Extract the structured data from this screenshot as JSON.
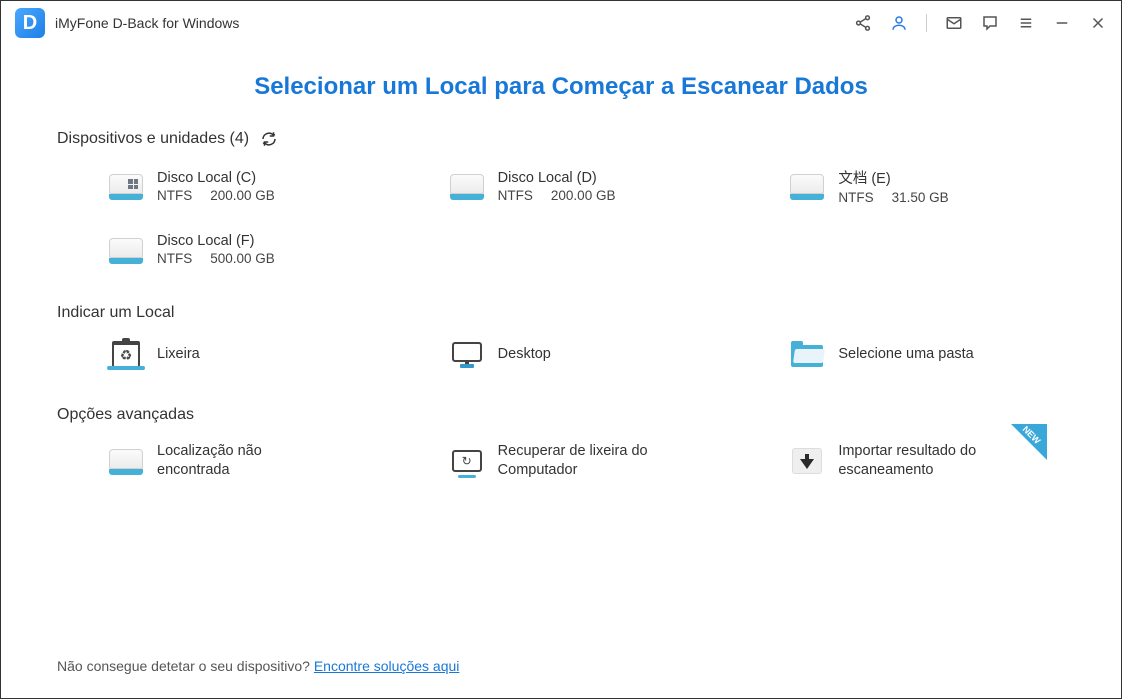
{
  "app": {
    "title": "iMyFone D-Back for Windows",
    "logo_letter": "D"
  },
  "page_title": "Selecionar um Local para Começar a Escanear Dados",
  "sections": {
    "devices": {
      "header": "Dispositivos e unidades (4)",
      "drives": [
        {
          "name": "Disco Local (C)",
          "fs": "NTFS",
          "size": "200.00 GB"
        },
        {
          "name": "Disco Local (D)",
          "fs": "NTFS",
          "size": "200.00 GB"
        },
        {
          "name": "文档 (E)",
          "fs": "NTFS",
          "size": "31.50 GB"
        },
        {
          "name": "Disco Local (F)",
          "fs": "NTFS",
          "size": "500.00 GB"
        }
      ]
    },
    "locations": {
      "header": "Indicar um Local",
      "items": [
        {
          "label": "Lixeira"
        },
        {
          "label": "Desktop"
        },
        {
          "label": "Selecione uma pasta"
        }
      ]
    },
    "advanced": {
      "header": "Opções avançadas",
      "items": [
        {
          "label": "Localização não encontrada"
        },
        {
          "label": "Recuperar de lixeira do Computador"
        },
        {
          "label": "Importar resultado do escaneamento",
          "new": true
        }
      ]
    }
  },
  "new_badge": "NEW",
  "footer": {
    "text": "Não consegue detetar o seu dispositivo? ",
    "link": "Encontre soluções aqui"
  }
}
